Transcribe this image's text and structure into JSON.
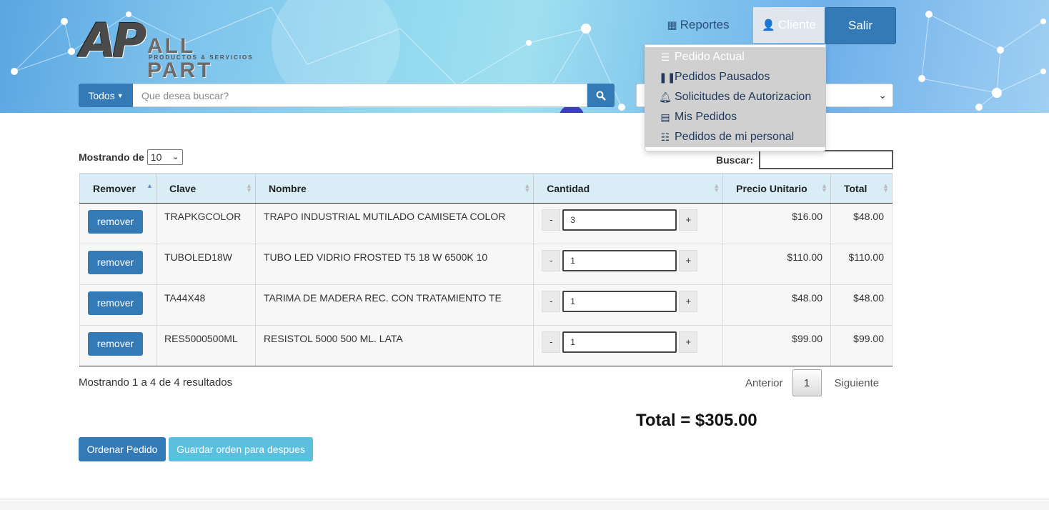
{
  "brand": {
    "logo_mark": "AP",
    "logo_text": "ALL PART",
    "logo_sub": "PRODUCTOS & SERVICIOS"
  },
  "nav": {
    "reportes": "Reportes",
    "cliente": "Cliente",
    "salir": "Salir"
  },
  "search": {
    "category": "Todos",
    "placeholder": "Que desea buscar?"
  },
  "dropdown": {
    "items": [
      {
        "label": "Pedido Actual",
        "icon": "menu-icon"
      },
      {
        "label": "Pedidos Pausados",
        "icon": "pause-icon"
      },
      {
        "label": "Solicitudes de Autorizacion",
        "icon": "bell-icon"
      },
      {
        "label": "Mis Pedidos",
        "icon": "list-icon"
      },
      {
        "label": "Pedidos de mi personal",
        "icon": "tasks-icon"
      }
    ]
  },
  "table_controls": {
    "length_label": "Mostrando de",
    "length_value": "10",
    "search_label": "Buscar:"
  },
  "table": {
    "headers": [
      "Remover",
      "Clave",
      "Nombre",
      "Cantidad",
      "Precio Unitario",
      "Total"
    ],
    "rows": [
      {
        "button": "remover",
        "clave": "TRAPKGCOLOR",
        "nombre": "TRAPO INDUSTRIAL MUTILADO CAMISETA COLOR",
        "cantidad": "3",
        "precio": "$16.00",
        "total": "$48.00"
      },
      {
        "button": "remover",
        "clave": "TUBOLED18W",
        "nombre": "TUBO LED VIDRIO FROSTED T5 18 W 6500K 10",
        "cantidad": "1",
        "precio": "$110.00",
        "total": "$110.00"
      },
      {
        "button": "remover",
        "clave": "TA44X48",
        "nombre": "TARIMA DE MADERA REC. CON TRATAMIENTO TE",
        "cantidad": "1",
        "precio": "$48.00",
        "total": "$48.00"
      },
      {
        "button": "remover",
        "clave": "RES5000500ML",
        "nombre": "RESISTOL 5000 500 ML. LATA",
        "cantidad": "1",
        "precio": "$99.00",
        "total": "$99.00"
      }
    ],
    "minus": "-",
    "plus": "+"
  },
  "info": "Mostrando 1 a 4 de 4 resultados",
  "pager": {
    "prev": "Anterior",
    "page": "1",
    "next": "Siguiente"
  },
  "total": "Total = $305.00",
  "actions": {
    "order": "Ordenar Pedido",
    "save": "Guardar orden para despues"
  },
  "colors": {
    "primary": "#337ab7",
    "info": "#5bc0de",
    "header_cell": "#d9edf7"
  }
}
